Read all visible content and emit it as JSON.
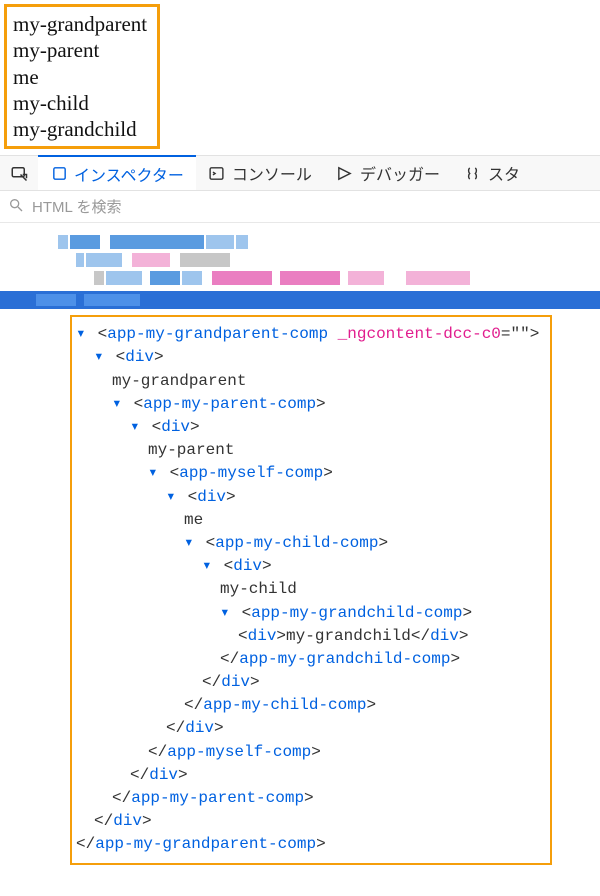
{
  "rendered": {
    "lines": [
      "my-grandparent",
      "my-parent",
      "me",
      "my-child",
      "my-grandchild"
    ]
  },
  "tabs": {
    "inspector": "インスペクター",
    "console": "コンソール",
    "debugger": "デバッガー",
    "style": "スタ"
  },
  "search": {
    "placeholder": "HTML を検索"
  },
  "tree": {
    "angle_open": "<",
    "angle_close": ">",
    "slash": "/",
    "eq": "=",
    "quote": "\"\"",
    "twisty": "▾",
    "grandparent_tag": "app-my-grandparent-comp",
    "grandparent_attr": "_ngcontent-dcc-c0",
    "parent_tag": "app-my-parent-comp",
    "myself_tag": "app-myself-comp",
    "child_tag": "app-my-child-comp",
    "grandchild_tag": "app-my-grandchild-comp",
    "div": "div",
    "text_grandparent": "my-grandparent",
    "text_parent": "my-parent",
    "text_me": "me",
    "text_child": "my-child",
    "text_grandchild": "my-grandchild"
  }
}
